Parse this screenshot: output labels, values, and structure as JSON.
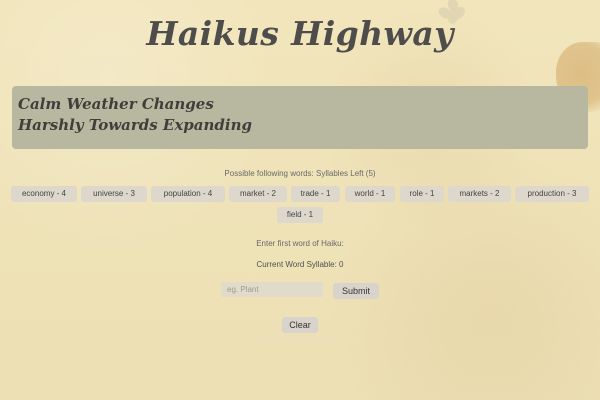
{
  "page": {
    "title": "Haikus Highway"
  },
  "haiku": {
    "line1": "Calm Weather Changes",
    "line2": "Harshly Towards Expanding"
  },
  "words": {
    "label": "Possible following words: Syllables Left (5)",
    "items": [
      "economy - 4",
      "universe - 3",
      "population - 4",
      "market - 2",
      "trade - 1",
      "world - 1",
      "role - 1",
      "markets - 2",
      "production - 3",
      "field - 1"
    ]
  },
  "entry": {
    "prompt": "Enter first word of Haiku:",
    "syllable_status": "Current Word Syllable: 0",
    "placeholder": "eg. Plant",
    "submit_label": "Submit",
    "clear_label": "Clear"
  }
}
